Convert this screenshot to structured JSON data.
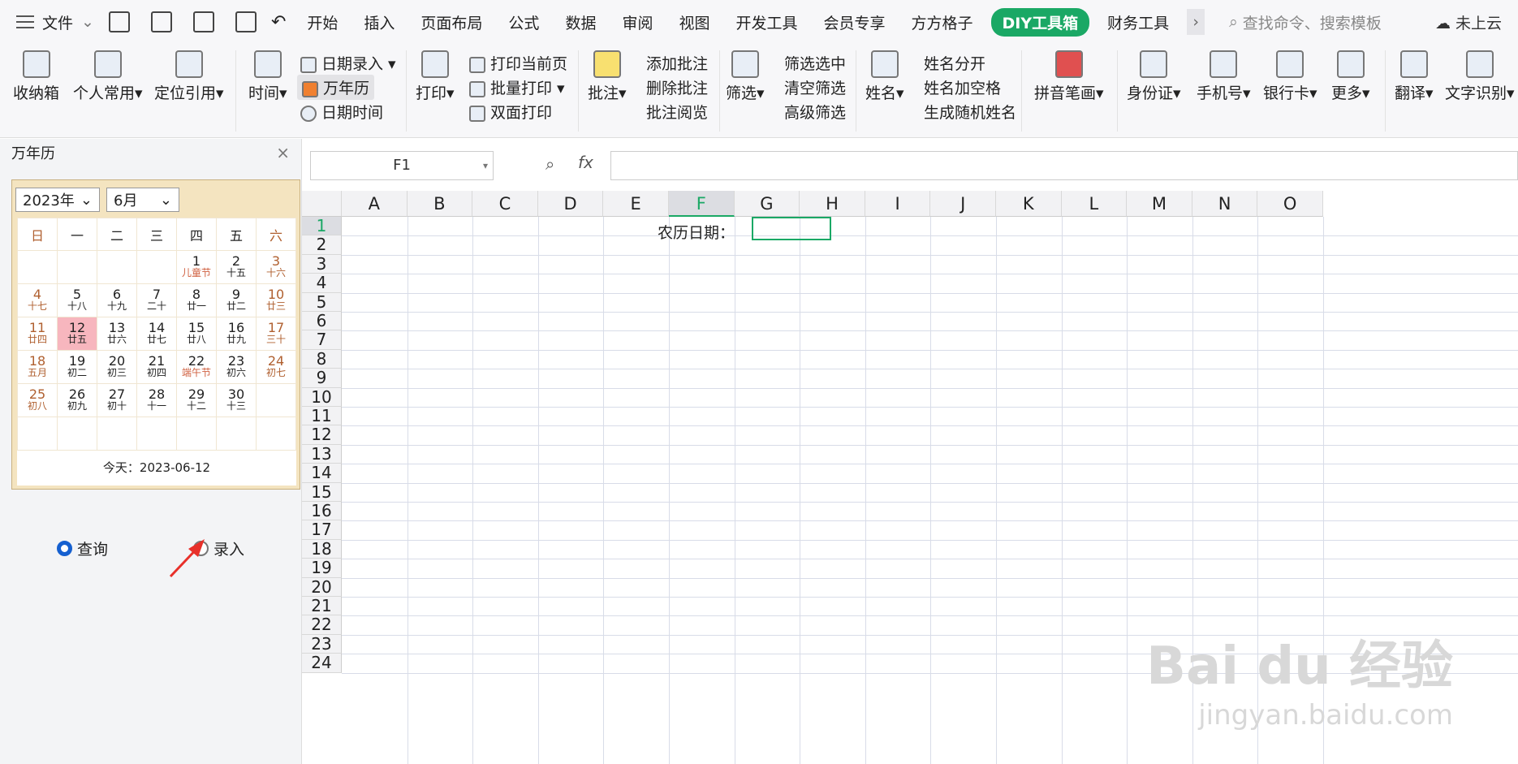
{
  "menubar": {
    "file": "文件",
    "tabs": [
      "开始",
      "插入",
      "页面布局",
      "公式",
      "数据",
      "审阅",
      "视图",
      "开发工具",
      "会员专享",
      "方方格子",
      "DIY工具箱",
      "财务工具"
    ],
    "search_placeholder": "查找命令、搜索模板",
    "cloud": "未上云"
  },
  "ribbon": {
    "storage": "收纳箱",
    "personal": "个人常用",
    "locate": "定位引用",
    "time": "时间",
    "date_entry": "日期录入",
    "calendar": "万年历",
    "datetime": "日期时间",
    "print": "打印",
    "print_current": "打印当前页",
    "batch_print": "批量打印",
    "duplex_print": "双面打印",
    "comment": "批注",
    "add_comment": "添加批注",
    "delete_comment": "删除批注",
    "read_comment": "批注阅览",
    "filter": "筛选",
    "filter_selected": "筛选选中",
    "clear_filter": "清空筛选",
    "advanced_filter": "高级筛选",
    "name": "姓名",
    "split_name": "姓名分开",
    "name_space": "姓名加空格",
    "random_name": "生成随机姓名",
    "pinyin": "拼音笔画",
    "id_card": "身份证",
    "phone": "手机号",
    "bank_card": "银行卡",
    "more": "更多",
    "translate": "翻译",
    "ocr": "文字识别"
  },
  "panel": {
    "title": "万年历",
    "year": "2023年",
    "month": "6月",
    "weekdays": [
      "日",
      "一",
      "二",
      "三",
      "四",
      "五",
      "六"
    ],
    "weeks": [
      [
        [
          "",
          ""
        ],
        [
          "",
          ""
        ],
        [
          "",
          ""
        ],
        [
          "",
          ""
        ],
        [
          "1",
          "儿童节"
        ],
        [
          "2",
          "十五"
        ],
        [
          "3",
          "十六"
        ]
      ],
      [
        [
          "4",
          "十七"
        ],
        [
          "5",
          "十八"
        ],
        [
          "6",
          "十九"
        ],
        [
          "7",
          "二十"
        ],
        [
          "8",
          "廿一"
        ],
        [
          "9",
          "廿二"
        ],
        [
          "10",
          "廿三"
        ]
      ],
      [
        [
          "11",
          "廿四"
        ],
        [
          "12",
          "廿五"
        ],
        [
          "13",
          "廿六"
        ],
        [
          "14",
          "廿七"
        ],
        [
          "15",
          "廿八"
        ],
        [
          "16",
          "廿九"
        ],
        [
          "17",
          "三十"
        ]
      ],
      [
        [
          "18",
          "五月"
        ],
        [
          "19",
          "初二"
        ],
        [
          "20",
          "初三"
        ],
        [
          "21",
          "初四"
        ],
        [
          "22",
          "端午节"
        ],
        [
          "23",
          "初六"
        ],
        [
          "24",
          "初七"
        ]
      ],
      [
        [
          "25",
          "初八"
        ],
        [
          "26",
          "初九"
        ],
        [
          "27",
          "初十"
        ],
        [
          "28",
          "十一"
        ],
        [
          "29",
          "十二"
        ],
        [
          "30",
          "十三"
        ],
        [
          "",
          ""
        ]
      ],
      [
        [
          "",
          ""
        ],
        [
          "",
          ""
        ],
        [
          "",
          ""
        ],
        [
          "",
          ""
        ],
        [
          "",
          ""
        ],
        [
          "",
          ""
        ],
        [
          "",
          ""
        ]
      ]
    ],
    "today_label": "今天：2023-06-12",
    "radio_query": "查询",
    "radio_entry": "录入"
  },
  "sheet": {
    "name_box": "F1",
    "fx": "fx",
    "columns": [
      "A",
      "B",
      "C",
      "D",
      "E",
      "F",
      "G",
      "H",
      "I",
      "J",
      "K",
      "L",
      "M",
      "N",
      "O"
    ],
    "rows": [
      "1",
      "2",
      "3",
      "4",
      "5",
      "6",
      "7",
      "8",
      "9",
      "10",
      "11",
      "12",
      "13",
      "14",
      "15",
      "16",
      "17",
      "18",
      "19",
      "20",
      "21",
      "22",
      "23",
      "24"
    ],
    "cell_E1": "农历日期："
  },
  "watermark": {
    "main": "Bai du 经验",
    "sub": "jingyan.baidu.com"
  }
}
